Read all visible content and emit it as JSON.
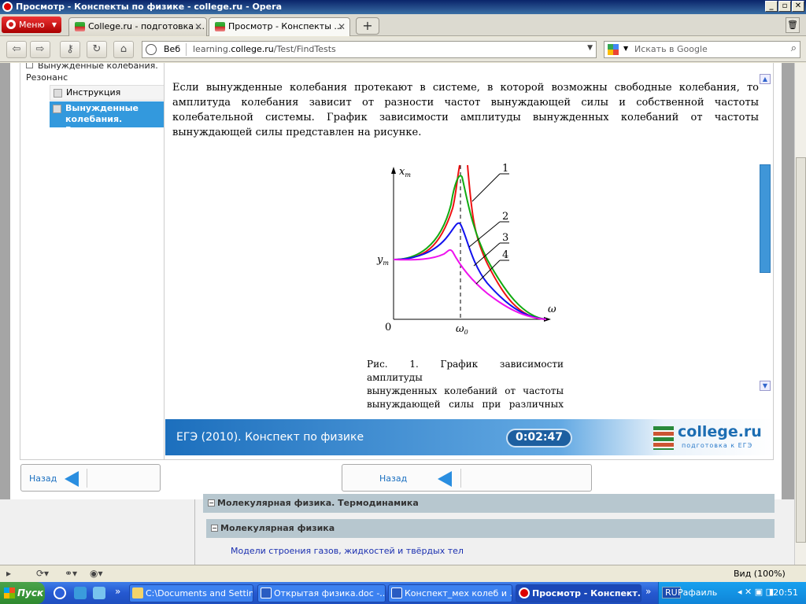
{
  "window": {
    "title": "Просмотр - Конспекты по физике - college.ru - Opera"
  },
  "browser": {
    "menu_label": "Меню",
    "tabs": [
      {
        "label": "College.ru - подготовка ..."
      },
      {
        "label": "Просмотр - Конспекты ..."
      }
    ],
    "new_tab": "+",
    "address": {
      "prefix": "Веб",
      "url_pre": "learning.",
      "url_host": "college.ru",
      "url_post": "/Test/FindTests"
    },
    "search_placeholder": "Искать в Google"
  },
  "app": {
    "sidebar": {
      "parent_label": "Вынужденные колебания. Резонанс",
      "items": [
        {
          "label": "Инструкция"
        },
        {
          "label": "Вынужденные колебания. Резонанс",
          "selected": true
        }
      ]
    },
    "paragraph_lines": [
      "Если вынужденные колебания протекают в системе, в которой возможны свободные колебания, то",
      "амплитуда колебания зависит от разности частот вынуждающей силы и собственной частоты",
      "колебательной системы. График зависимости амплитуды вынужденных колебаний от частоты",
      "вынуждающей силы представлен на рисунке."
    ],
    "figure": {
      "y_label": "x",
      "y_label_sub": "m",
      "y0_label": "y",
      "y0_label_sub": "m",
      "origin_label": "0",
      "x_label": "ω",
      "omega0_label": "ω",
      "omega0_sub": "0",
      "curve_labels": [
        "1",
        "2",
        "3",
        "4"
      ],
      "colors": {
        "c1": "#ee1111",
        "c2": "#11aa11",
        "c3": "#1111ee",
        "c4": "#ee11ee"
      }
    },
    "caption_lines": [
      "Рис. 1. График зависимости амплитуды",
      "вынужденных колебаний от частоты",
      "вынуждающей силы при различных"
    ],
    "footer": {
      "title": "ЕГЭ (2010). Конспект по физике",
      "timer": "0:02:47",
      "brand_name": "college.ru",
      "brand_tagline": "подготовка к ЕГЭ"
    },
    "back_left": "Назад",
    "back_center": "Назад"
  },
  "page": {
    "section1": "Молекулярная физика. Термодинамика",
    "section2": "Молекулярная физика",
    "link": "Модели строения газов, жидкостей и твёрдых тел"
  },
  "status": {
    "zoom": "Вид (100%)"
  },
  "taskbar": {
    "start": "Пуск",
    "items": [
      {
        "label": "C:\\Documents and Settin..."
      },
      {
        "label": "Открытая физика.doc -..."
      },
      {
        "label": "Конспект_мех колеб и ..."
      },
      {
        "label": "Просмотр - Конспект...",
        "active": true
      }
    ],
    "lang": "RU",
    "user": "Рафаиль",
    "clock": "20:51"
  }
}
